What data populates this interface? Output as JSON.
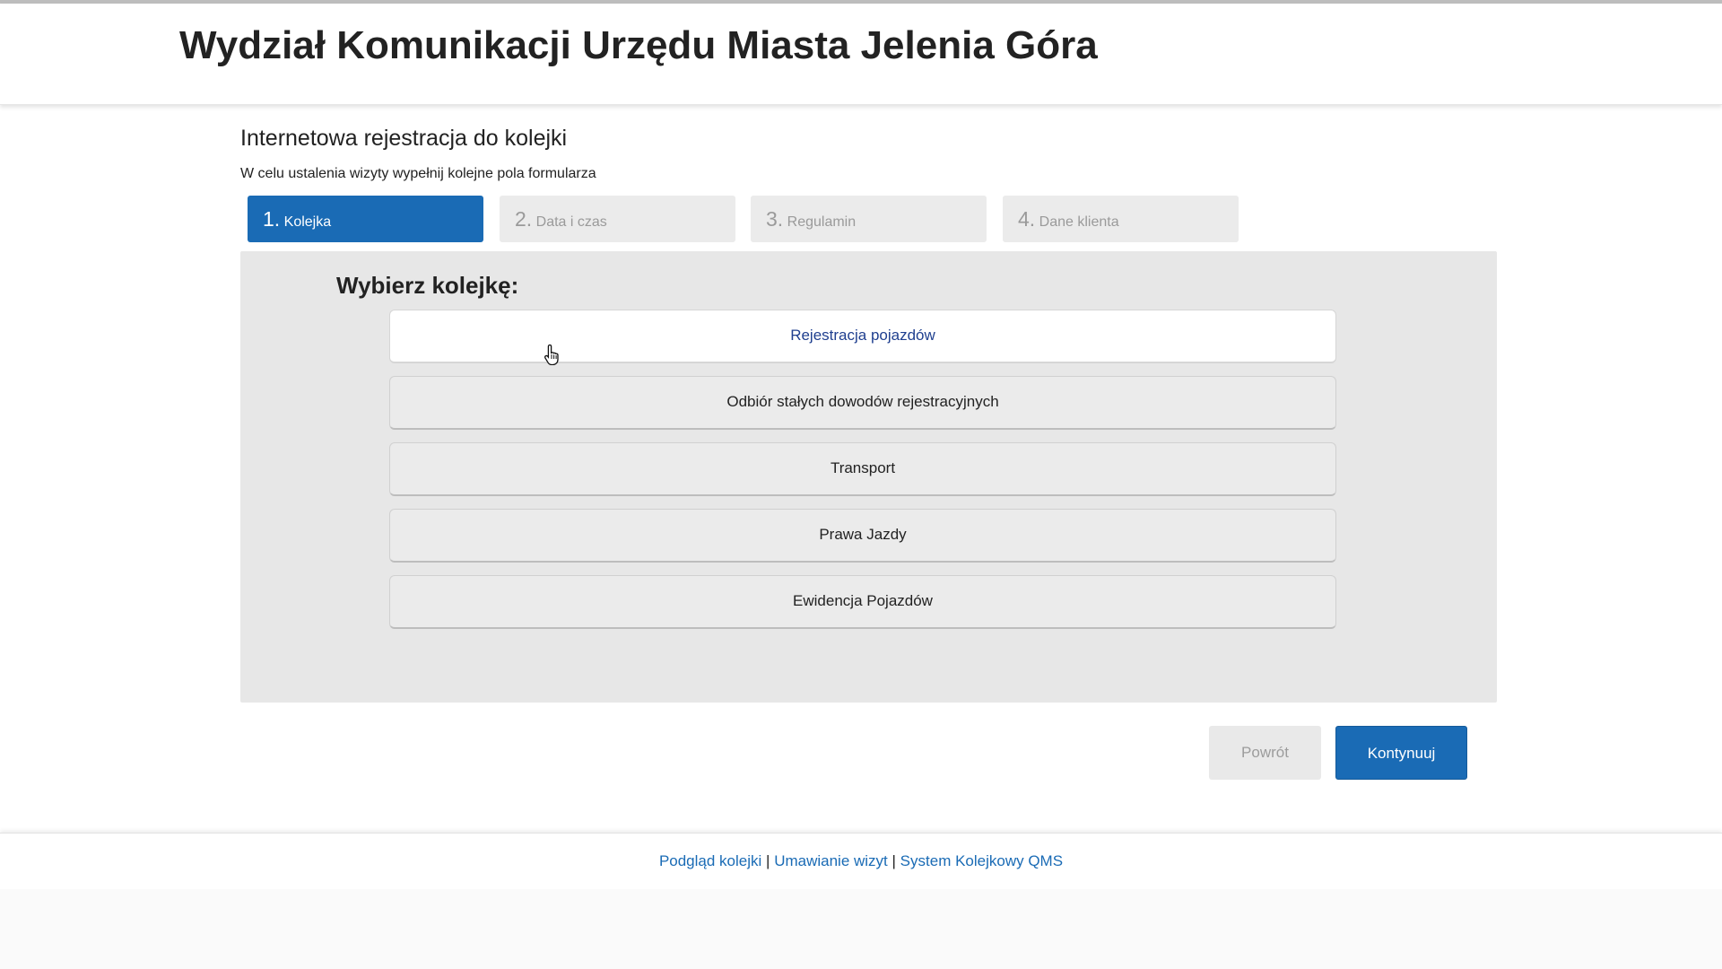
{
  "header": {
    "title": "Wydział Komunikacji Urzędu Miasta Jelenia Góra"
  },
  "page": {
    "subtitle": "Internetowa rejestracja do kolejki",
    "description": "W celu ustalenia wizyty wypełnij kolejne pola formularza"
  },
  "steps": [
    {
      "num": "1.",
      "label": "Kolejka",
      "active": true
    },
    {
      "num": "2.",
      "label": "Data i czas",
      "active": false
    },
    {
      "num": "3.",
      "label": "Regulamin",
      "active": false
    },
    {
      "num": "4.",
      "label": "Dane klienta",
      "active": false
    }
  ],
  "panel": {
    "heading": "Wybierz kolejkę:",
    "options": [
      "Rejestracja pojazdów",
      "Odbiór stałych dowodów rejestracyjnych",
      "Transport",
      "Prawa Jazdy",
      "Ewidencja Pojazdów"
    ]
  },
  "buttons": {
    "back": "Powrót",
    "next": "Kontynuuj"
  },
  "footer": {
    "link1": "Podgląd kolejki",
    "separator": "|",
    "link2": "Umawianie wizyt",
    "link3": "System Kolejkowy QMS"
  },
  "colors": {
    "primary": "#1a6bb5",
    "panel_bg": "#e7e7e7",
    "hover_text": "#1f3f8f"
  },
  "icons": {
    "cursor": "hand-pointer-icon"
  }
}
